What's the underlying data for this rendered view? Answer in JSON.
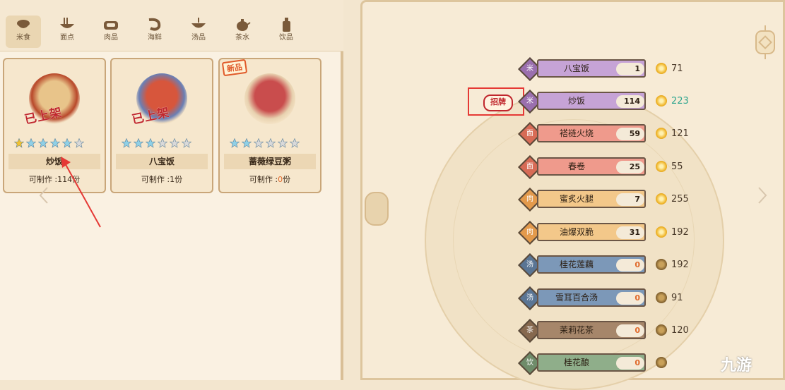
{
  "tabs": [
    {
      "label": "米食",
      "icon": "rice-bowl-icon",
      "active": true
    },
    {
      "label": "面点",
      "icon": "noodle-bowl-icon",
      "active": false
    },
    {
      "label": "肉品",
      "icon": "meat-icon",
      "active": false
    },
    {
      "label": "海鲜",
      "icon": "shrimp-icon",
      "active": false
    },
    {
      "label": "汤品",
      "icon": "soup-bowl-icon",
      "active": false
    },
    {
      "label": "茶水",
      "icon": "teapot-icon",
      "active": false
    },
    {
      "label": "饮品",
      "icon": "drink-bottle-icon",
      "active": false
    }
  ],
  "cards": [
    {
      "name": "炒饭",
      "craft_prefix": "可制作 :",
      "craft_count": "114",
      "craft_suffix": "份",
      "stars_filled": 1,
      "stars_blue": 5,
      "stamp": "已上架",
      "new_tag": ""
    },
    {
      "name": "八宝饭",
      "craft_prefix": "可制作 :",
      "craft_count": "1",
      "craft_suffix": "份",
      "stars_filled": 0,
      "stars_blue": 3,
      "stamp": "已上架",
      "new_tag": ""
    },
    {
      "name": "蔷薇绿豆粥",
      "craft_prefix": "可制作 :",
      "craft_count": "0",
      "craft_suffix": "份",
      "stars_filled": 0,
      "stars_blue": 2,
      "stamp": "",
      "new_tag": "新品"
    }
  ],
  "menu": [
    {
      "tag": "米",
      "name": "八宝饭",
      "qty": "1",
      "price": "71",
      "color": "#c6a3d6",
      "tagcolor": "#9a6fae"
    },
    {
      "tag": "米",
      "name": "炒饭",
      "qty": "114",
      "price": "223",
      "color": "#c6a3d6",
      "tagcolor": "#9a6fae",
      "highlight": true
    },
    {
      "tag": "面",
      "name": "褡裢火烧",
      "qty": "59",
      "price": "121",
      "color": "#ef9a8c",
      "tagcolor": "#d76b56"
    },
    {
      "tag": "面",
      "name": "春卷",
      "qty": "25",
      "price": "55",
      "color": "#ef9a8c",
      "tagcolor": "#d76b56"
    },
    {
      "tag": "肉",
      "name": "蜜炙火腿",
      "qty": "7",
      "price": "255",
      "color": "#f3c88a",
      "tagcolor": "#e39a4c"
    },
    {
      "tag": "肉",
      "name": "油爆双脆",
      "qty": "31",
      "price": "192",
      "color": "#f3c88a",
      "tagcolor": "#e39a4c"
    },
    {
      "tag": "汤",
      "name": "桂花莲藕",
      "qty": "0",
      "price": "192",
      "color": "#7c98b8",
      "tagcolor": "#5a7594"
    },
    {
      "tag": "汤",
      "name": "雪耳百合汤",
      "qty": "0",
      "price": "91",
      "color": "#7c98b8",
      "tagcolor": "#5a7594"
    },
    {
      "tag": "茶",
      "name": "茉莉花茶",
      "qty": "0",
      "price": "120",
      "color": "#a6866a",
      "tagcolor": "#86684e"
    },
    {
      "tag": "饮",
      "name": "桂花酿",
      "qty": "0",
      "price": "",
      "color": "#8fae8a",
      "tagcolor": "#6f8c6a"
    }
  ],
  "signature_label": "招牌",
  "watermark": "九游"
}
